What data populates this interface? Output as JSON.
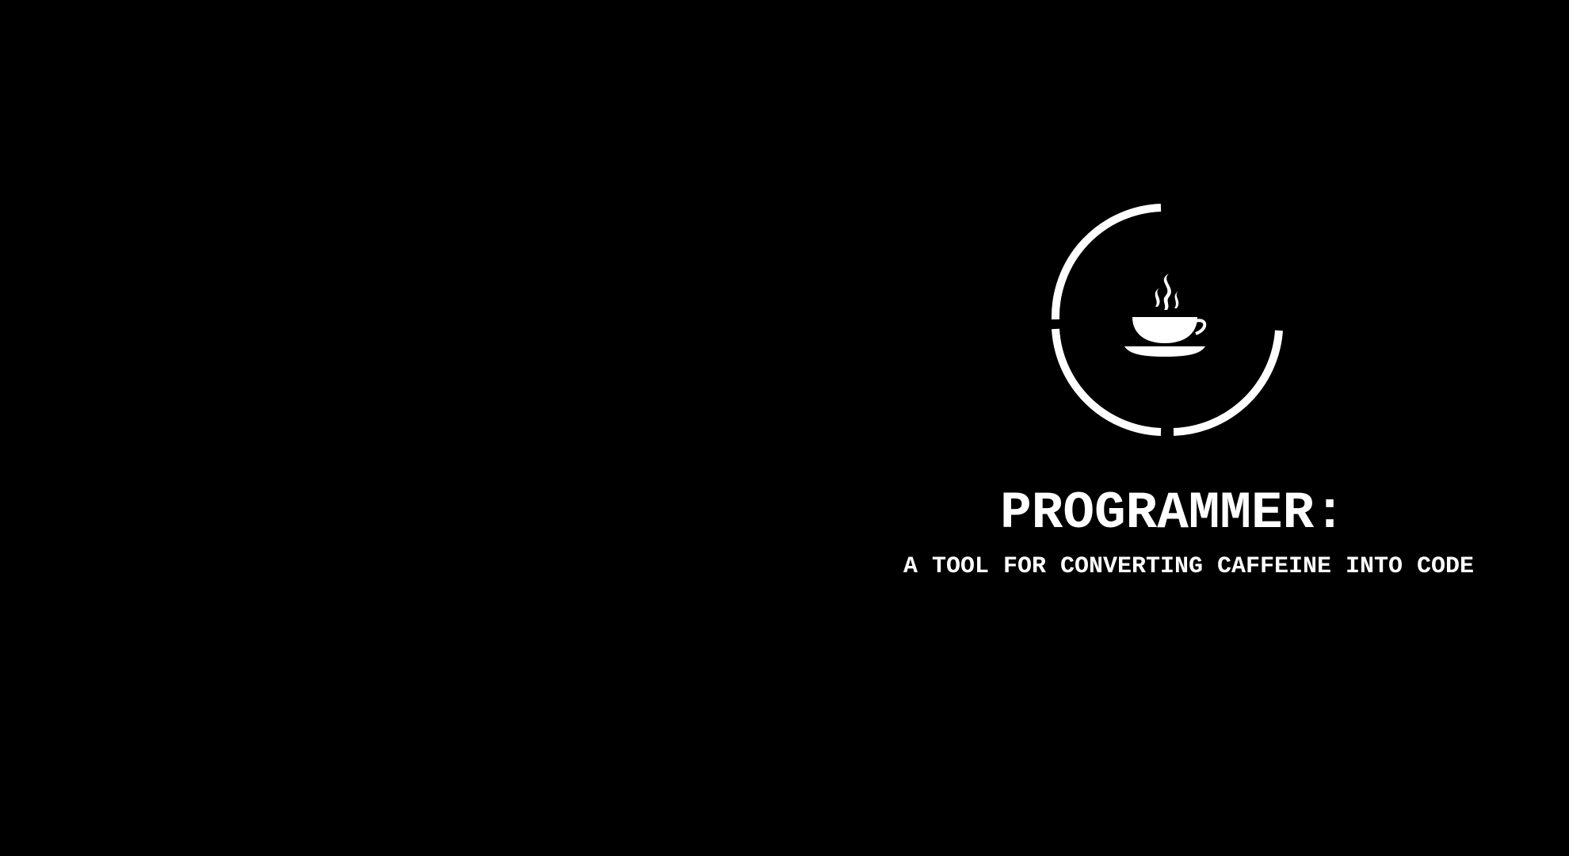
{
  "wallpaper": {
    "background_color": "#000000",
    "foreground_color": "#ffffff",
    "emblem": {
      "icon": "coffee-cup-icon",
      "ring": "segmented-ring"
    },
    "title": "PROGRAMMER:",
    "subtitle": "A TOOL FOR CONVERTING CAFFEINE INTO CODE"
  }
}
